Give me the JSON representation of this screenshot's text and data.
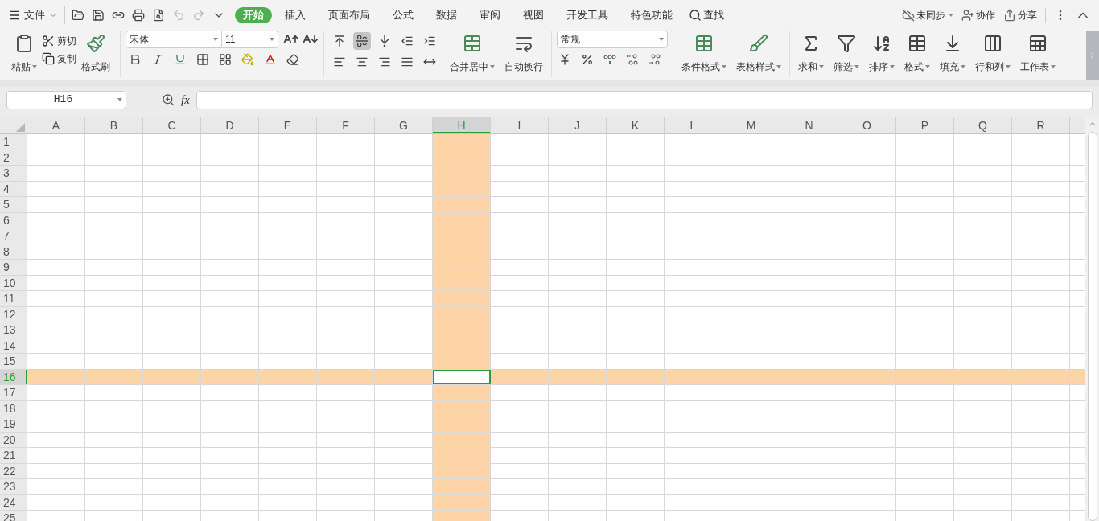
{
  "menu": {
    "label": "文件"
  },
  "tabs": [
    {
      "label": "开始",
      "selected": true
    },
    {
      "label": "插入",
      "selected": false
    },
    {
      "label": "页面布局",
      "selected": false
    },
    {
      "label": "公式",
      "selected": false
    },
    {
      "label": "数据",
      "selected": false
    },
    {
      "label": "审阅",
      "selected": false
    },
    {
      "label": "视图",
      "selected": false
    },
    {
      "label": "开发工具",
      "selected": false
    },
    {
      "label": "特色功能",
      "selected": false
    }
  ],
  "search": {
    "label": "查找"
  },
  "top_right": {
    "sync": "未同步",
    "collaborate": "协作",
    "share": "分享"
  },
  "clipboard": {
    "paste": "粘贴",
    "cut": "剪切",
    "copy": "复制",
    "format_painter": "格式刷"
  },
  "font": {
    "name": "宋体",
    "size": "11"
  },
  "alignment": [
    {
      "kind": "top",
      "selected": false
    },
    {
      "kind": "middle",
      "selected": true
    },
    {
      "kind": "bottom",
      "selected": false
    },
    {
      "kind": "outdent",
      "selected": false
    },
    {
      "kind": "indent",
      "selected": false
    },
    {
      "kind": "left",
      "selected": false
    },
    {
      "kind": "center",
      "selected": false
    },
    {
      "kind": "right",
      "selected": false
    },
    {
      "kind": "justify",
      "selected": false
    },
    {
      "kind": "distributed",
      "selected": false
    }
  ],
  "merge_buttons": [
    "合并居中",
    "自动换行"
  ],
  "number_format": "常规",
  "style_buttons": [
    "条件格式",
    "表格样式"
  ],
  "edit_buttons": [
    "求和",
    "筛选",
    "排序",
    "格式",
    "填充",
    "行和列",
    "工作表"
  ],
  "name_box": "H16",
  "formula_label": "fx",
  "columns": [
    {
      "label": "A",
      "selected": false
    },
    {
      "label": "B",
      "selected": false
    },
    {
      "label": "C",
      "selected": false
    },
    {
      "label": "D",
      "selected": false
    },
    {
      "label": "E",
      "selected": false
    },
    {
      "label": "F",
      "selected": false
    },
    {
      "label": "G",
      "selected": false
    },
    {
      "label": "H",
      "selected": true
    },
    {
      "label": "I",
      "selected": false
    },
    {
      "label": "J",
      "selected": false
    },
    {
      "label": "K",
      "selected": false
    },
    {
      "label": "L",
      "selected": false
    },
    {
      "label": "M",
      "selected": false
    },
    {
      "label": "N",
      "selected": false
    },
    {
      "label": "O",
      "selected": false
    },
    {
      "label": "P",
      "selected": false
    },
    {
      "label": "Q",
      "selected": false
    },
    {
      "label": "R",
      "selected": false
    }
  ],
  "rows": [
    {
      "label": "1",
      "selected": false
    },
    {
      "label": "2",
      "selected": false
    },
    {
      "label": "3",
      "selected": false
    },
    {
      "label": "4",
      "selected": false
    },
    {
      "label": "5",
      "selected": false
    },
    {
      "label": "6",
      "selected": false
    },
    {
      "label": "7",
      "selected": false
    },
    {
      "label": "8",
      "selected": false
    },
    {
      "label": "9",
      "selected": false
    },
    {
      "label": "10",
      "selected": false
    },
    {
      "label": "11",
      "selected": false
    },
    {
      "label": "12",
      "selected": false
    },
    {
      "label": "13",
      "selected": false
    },
    {
      "label": "14",
      "selected": false
    },
    {
      "label": "15",
      "selected": false
    },
    {
      "label": "16",
      "selected": true
    },
    {
      "label": "17",
      "selected": false
    },
    {
      "label": "18",
      "selected": false
    },
    {
      "label": "19",
      "selected": false
    },
    {
      "label": "20",
      "selected": false
    },
    {
      "label": "21",
      "selected": false
    },
    {
      "label": "22",
      "selected": false
    },
    {
      "label": "23",
      "selected": false
    },
    {
      "label": "24",
      "selected": false
    },
    {
      "label": "25",
      "selected": false
    }
  ]
}
